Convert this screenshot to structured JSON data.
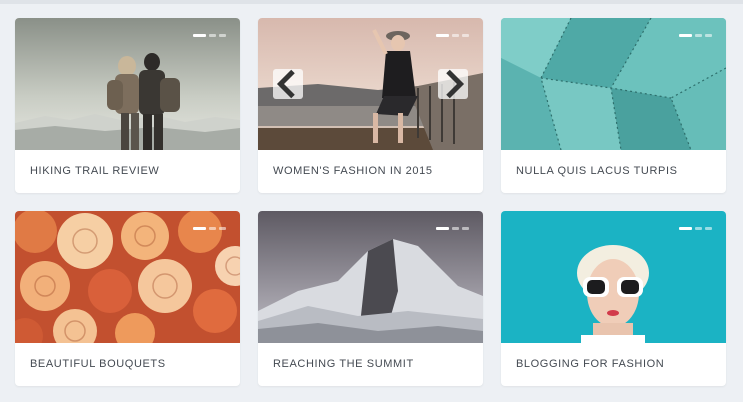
{
  "cards": [
    {
      "title": "HIKING TRAIL REVIEW",
      "image": "couple-hiking-photo",
      "has_dots": true
    },
    {
      "title": "WOMEN'S FASHION IN 2015",
      "image": "woman-on-pier-photo",
      "has_dots": true,
      "has_arrows": true
    },
    {
      "title": "NULLA QUIS LACUS TURPIS",
      "image": "teal-agave-photo",
      "has_dots": true
    },
    {
      "title": "BEAUTIFUL BOUQUETS",
      "image": "roses-photo",
      "has_dots": true
    },
    {
      "title": "REACHING THE SUMMIT",
      "image": "half-dome-mountain-photo",
      "has_dots": true
    },
    {
      "title": "BLOGGING FOR FASHION",
      "image": "woman-sunglasses-photo",
      "has_dots": true
    }
  ],
  "slider": {
    "active_index": 0,
    "total": 3
  },
  "icons": {
    "prev": "chevron-left-icon",
    "next": "chevron-right-icon"
  },
  "colors": {
    "background": "#edf0f4",
    "card": "#ffffff",
    "title_text": "#444a52"
  }
}
